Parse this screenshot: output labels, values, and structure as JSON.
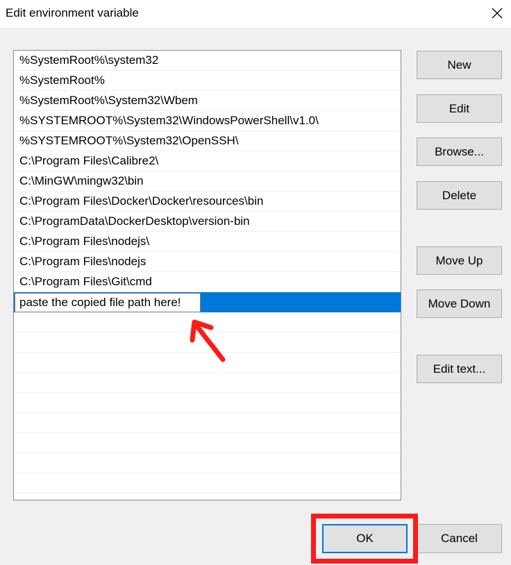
{
  "window": {
    "title": "Edit environment variable"
  },
  "entries": [
    "%SystemRoot%\\system32",
    "%SystemRoot%",
    "%SystemRoot%\\System32\\Wbem",
    "%SYSTEMROOT%\\System32\\WindowsPowerShell\\v1.0\\",
    "%SYSTEMROOT%\\System32\\OpenSSH\\",
    "C:\\Program Files\\Calibre2\\",
    "C:\\MinGW\\mingw32\\bin",
    "C:\\Program Files\\Docker\\Docker\\resources\\bin",
    "C:\\ProgramData\\DockerDesktop\\version-bin",
    "C:\\Program Files\\nodejs\\",
    "C:\\Program Files\\nodejs",
    "C:\\Program Files\\Git\\cmd"
  ],
  "editing": {
    "value": "paste the copied file path here!"
  },
  "buttons": {
    "new": "New",
    "edit": "Edit",
    "browse": "Browse...",
    "delete": "Delete",
    "move_up": "Move Up",
    "move_down": "Move Down",
    "edit_text": "Edit text...",
    "ok": "OK",
    "cancel": "Cancel"
  },
  "colors": {
    "selection": "#0078d7",
    "annotation": "#ff1a1a"
  },
  "icons": {
    "close": "close-icon"
  }
}
